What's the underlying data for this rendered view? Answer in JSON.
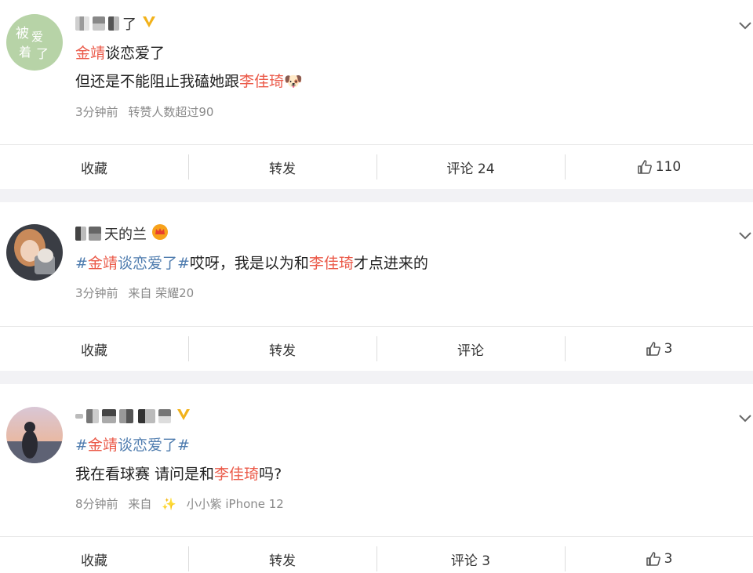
{
  "posts": [
    {
      "username_visible": "了",
      "badge": "vip-v-icon",
      "lines": [
        [
          {
            "text": "金靖",
            "style": "red"
          },
          {
            "text": "谈恋爱了",
            "style": "plain"
          }
        ],
        [
          {
            "text": "但还是不能阻止我磕她跟",
            "style": "plain"
          },
          {
            "text": "李佳琦",
            "style": "red"
          },
          {
            "text": "🐶",
            "style": "emoji"
          }
        ]
      ],
      "meta": [
        "3分钟前",
        "转赞人数超过90"
      ],
      "actions": {
        "favorite": "收藏",
        "repost": "转发",
        "comment": "评论 24",
        "like": "110"
      }
    },
    {
      "username_visible": "天的兰",
      "badge": "crown-icon",
      "lines": [
        [
          {
            "text": "#",
            "style": "blue"
          },
          {
            "text": "金靖",
            "style": "red"
          },
          {
            "text": "谈恋爱了#",
            "style": "blue"
          },
          {
            "text": "哎呀，我是以为和",
            "style": "plain"
          },
          {
            "text": "李佳琦",
            "style": "red"
          },
          {
            "text": "才点进来的",
            "style": "plain"
          }
        ]
      ],
      "meta": [
        "3分钟前",
        "来自 荣耀20"
      ],
      "actions": {
        "favorite": "收藏",
        "repost": "转发",
        "comment": "评论",
        "like": "3"
      }
    },
    {
      "username_visible": "",
      "badge": "vip-v-icon",
      "lines": [
        [
          {
            "text": "#",
            "style": "blue"
          },
          {
            "text": "金靖",
            "style": "red"
          },
          {
            "text": "谈恋爱了#",
            "style": "blue"
          }
        ],
        [
          {
            "text": "我在看球赛 请问是和",
            "style": "plain"
          },
          {
            "text": "李佳琦",
            "style": "red"
          },
          {
            "text": "吗?",
            "style": "plain"
          }
        ]
      ],
      "meta": [
        "8分钟前",
        "来自",
        "✨",
        "小小紫 iPhone 12"
      ],
      "actions": {
        "favorite": "收藏",
        "repost": "转发",
        "comment": "评论 3",
        "like": "3"
      }
    }
  ],
  "colors": {
    "highlight_red": "#eb5a49",
    "topic_blue": "#507daf",
    "meta_gray": "#8a8a8a",
    "vip_gold": "#f2b21b"
  }
}
